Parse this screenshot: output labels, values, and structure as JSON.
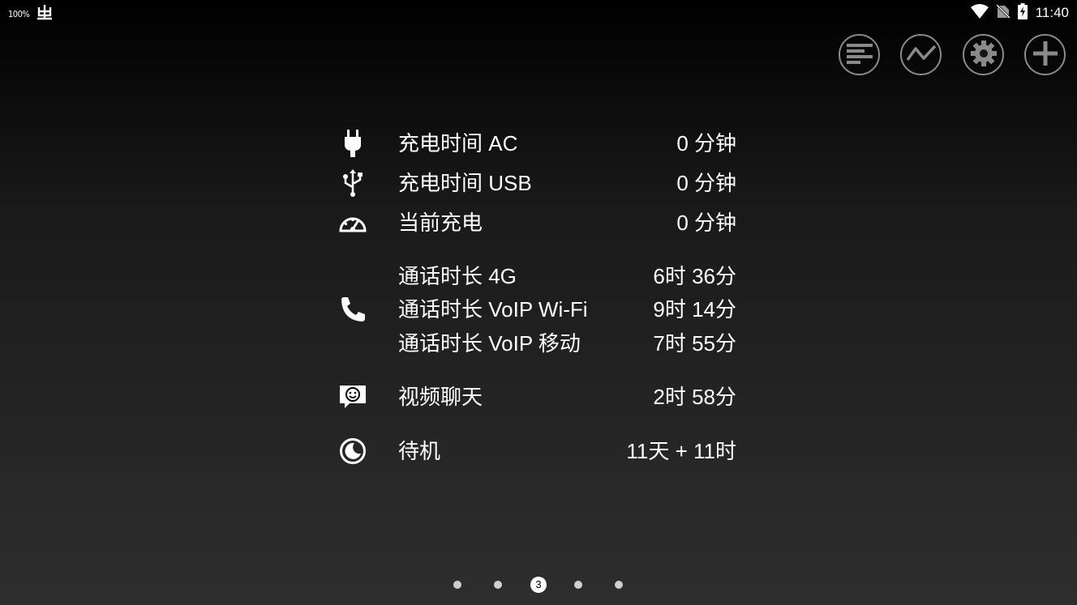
{
  "status_bar": {
    "battery_percent": "100%",
    "time": "11:40",
    "left_icons": [
      "bug-icon"
    ],
    "right_icons": [
      "wifi-icon",
      "no-sim-icon",
      "battery-charging-icon"
    ]
  },
  "toolbar": {
    "buttons": [
      "list-icon",
      "trend-icon",
      "gear-icon",
      "plus-icon"
    ]
  },
  "stats": [
    {
      "icon": "plug-icon",
      "label": "充电时间 AC",
      "value": "0 分钟"
    },
    {
      "icon": "usb-icon",
      "label": "充电时间 USB",
      "value": "0 分钟"
    },
    {
      "icon": "speedometer-icon",
      "label": "当前充电",
      "value": "0 分钟"
    },
    {
      "icon": "phone-icon",
      "label": "通话时长 4G",
      "value": "6时 36分"
    },
    {
      "label": "通话时长 VoIP Wi-Fi",
      "value": "9时 14分"
    },
    {
      "label": "通话时长 VoIP 移动",
      "value": "7时 55分"
    },
    {
      "icon": "video-chat-icon",
      "label": "视频聊天",
      "value": "2时 58分"
    },
    {
      "icon": "standby-moon-icon",
      "label": "待机",
      "value": "11天 + 11时"
    }
  ],
  "pager": {
    "total": 5,
    "current": "3"
  },
  "colors": {
    "background_top": "#000000",
    "background_bottom": "#2e2e2e",
    "button_ring": "#8a8a8a"
  }
}
